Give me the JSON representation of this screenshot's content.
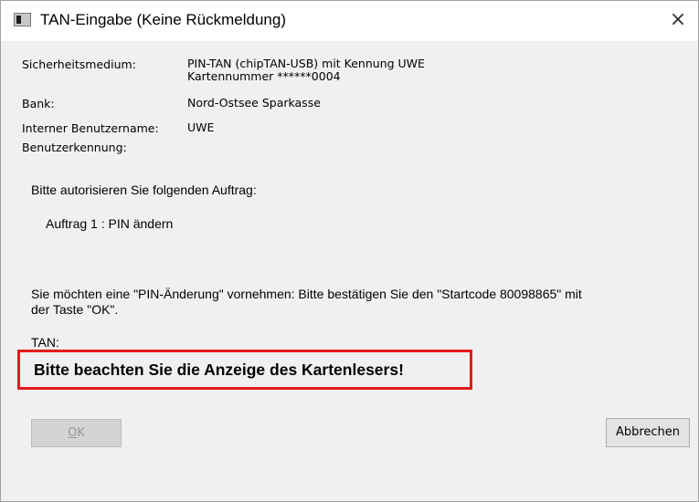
{
  "window": {
    "title": "TAN-Eingabe (Keine Rückmeldung)",
    "icon": "app-window-icon",
    "close_glyph": "×"
  },
  "details": {
    "security_medium_label": "Sicherheitsmedium:",
    "security_medium_line1": "PIN-TAN (chipTAN-USB) mit Kennung UWE",
    "security_medium_line2": "Kartennummer ******0004",
    "bank_label": "Bank:",
    "bank_value": "Nord-Ostsee Sparkasse",
    "internal_user_label": "Interner Benutzername:",
    "internal_user_value": "UWE",
    "user_id_label": "Benutzerkennung:",
    "user_id_value": ""
  },
  "message": {
    "authorize_prompt": "Bitte autorisieren Sie folgenden Auftrag:",
    "order": "Auftrag 1 : PIN ändern",
    "instruction_line1": "Sie möchten eine \"PIN-Änderung\" vornehmen: Bitte bestätigen Sie den \"Startcode 80098865\" mit",
    "instruction_line2": "der Taste \"OK\".",
    "tan_label": "TAN:",
    "card_reader_notice": "Bitte beachten Sie die Anzeige des Kartenlesers!"
  },
  "buttons": {
    "ok_mnemonic": "O",
    "ok_rest": "K",
    "cancel_label": "Abbrechen"
  },
  "colors": {
    "highlight_border": "#e21a1a",
    "dialog_background": "#f0f0f0"
  }
}
